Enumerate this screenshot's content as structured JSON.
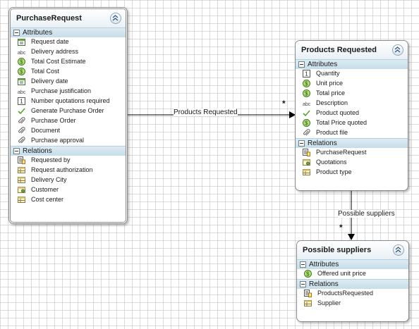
{
  "entities": {
    "purchase_request": {
      "title": "PurchaseRequest",
      "attributes_label": "Attributes",
      "relations_label": "Relations",
      "attributes": [
        {
          "icon": "calendar-icon",
          "label": "Request date"
        },
        {
          "icon": "text-icon",
          "label": "Delivery address"
        },
        {
          "icon": "currency-icon",
          "label": "Total Cost Estimate"
        },
        {
          "icon": "currency-icon",
          "label": "Total Cost"
        },
        {
          "icon": "calendar-icon",
          "label": "Delivery date"
        },
        {
          "icon": "text-icon",
          "label": "Purchase justification"
        },
        {
          "icon": "number-icon",
          "label": "Number quotations required"
        },
        {
          "icon": "checkmark-icon",
          "label": "Generate Purchase Order"
        },
        {
          "icon": "paperclip-icon",
          "label": "Purchase Order"
        },
        {
          "icon": "paperclip-icon",
          "label": "Document"
        },
        {
          "icon": "paperclip-icon",
          "label": "Purchase approval"
        }
      ],
      "relations": [
        {
          "icon": "entity-list-icon",
          "label": "Requested by"
        },
        {
          "icon": "table-icon",
          "label": "Request authorization"
        },
        {
          "icon": "table-icon",
          "label": "Delivery City"
        },
        {
          "icon": "entity-user-icon",
          "label": "Customer"
        },
        {
          "icon": "table-icon",
          "label": "Cost center"
        }
      ]
    },
    "products_requested": {
      "title": "Products Requested",
      "attributes_label": "Attributes",
      "relations_label": "Relations",
      "attributes": [
        {
          "icon": "number-icon",
          "label": "Quantity"
        },
        {
          "icon": "currency-icon",
          "label": "Unit price"
        },
        {
          "icon": "currency-icon",
          "label": "Total price"
        },
        {
          "icon": "text-icon",
          "label": "Description"
        },
        {
          "icon": "checkmark-icon",
          "label": "Product quoted"
        },
        {
          "icon": "currency-icon",
          "label": "Total Price quoted"
        },
        {
          "icon": "paperclip-icon",
          "label": "Product file"
        }
      ],
      "relations": [
        {
          "icon": "entity-list-icon",
          "label": "PurchaseRequest"
        },
        {
          "icon": "entity-user-icon",
          "label": "Quotations"
        },
        {
          "icon": "table-icon",
          "label": "Product type"
        }
      ]
    },
    "possible_suppliers": {
      "title": "Possible suppliers",
      "attributes_label": "Attributes",
      "relations_label": "Relations",
      "attributes": [
        {
          "icon": "currency-icon",
          "label": "Offered unit price"
        }
      ],
      "relations": [
        {
          "icon": "entity-list-icon",
          "label": "ProductsRequested"
        },
        {
          "icon": "table-icon",
          "label": "Supplier"
        }
      ]
    }
  },
  "connections": [
    {
      "label": "Products Requested",
      "multiplicity": "*"
    },
    {
      "label": "Possible suppliers",
      "multiplicity": "*"
    }
  ]
}
